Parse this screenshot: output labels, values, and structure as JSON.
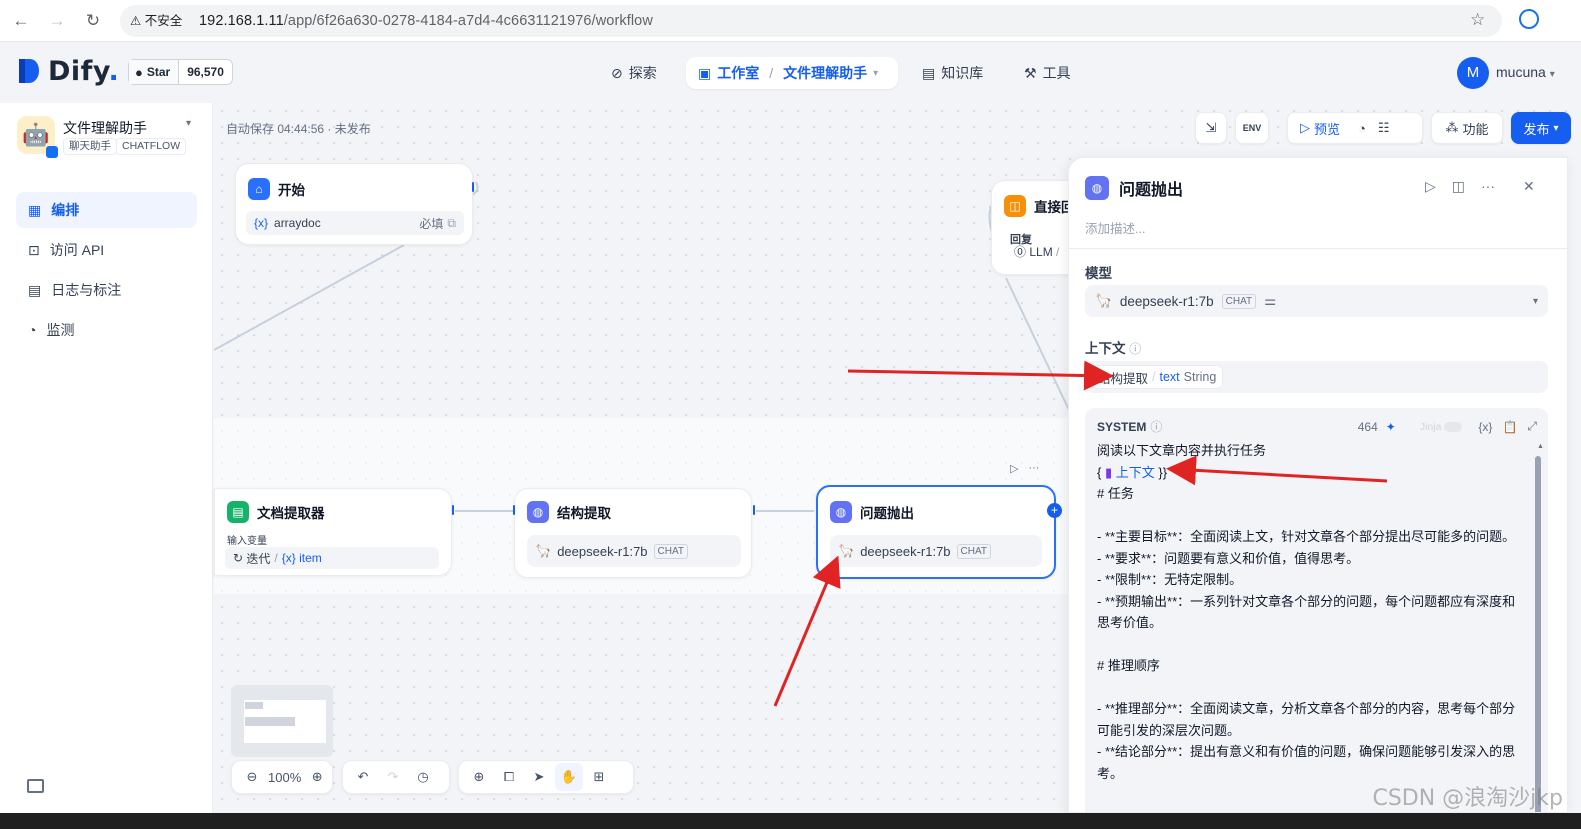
{
  "browser": {
    "insecure_label": "不安全",
    "url_host": "192.168.1.11",
    "url_path": "/app/6f26a630-0278-4184-a7d4-4c6631121976/workflow"
  },
  "header": {
    "logo": "Dify",
    "github_star_label": "Star",
    "github_star_count": "96,570",
    "nav_explore": "探索",
    "nav_studio": "工作室",
    "current_app": "文件理解助手",
    "nav_knowledge": "知识库",
    "nav_tools": "工具",
    "avatar_initial": "M",
    "username": "mucuna"
  },
  "sidebar": {
    "app_name": "文件理解助手",
    "tag_mode": "聊天助手",
    "tag_type": "CHATFLOW",
    "items": [
      {
        "label": "编排",
        "icon": "layout-icon"
      },
      {
        "label": "访问 API",
        "icon": "terminal-icon"
      },
      {
        "label": "日志与标注",
        "icon": "doc-icon"
      },
      {
        "label": "监测",
        "icon": "gauge-icon"
      }
    ]
  },
  "canvas": {
    "autosave": "自动保存 04:44:56 · 未发布",
    "zoom": "100%",
    "start_node": {
      "title": "开始",
      "var": "arraydoc",
      "required": "必填"
    },
    "reply_node": {
      "title": "直接回",
      "label": "回复",
      "llm": "LLM"
    },
    "extractor_node": {
      "title": "文档提取器",
      "input_label": "输入变量",
      "iter": "迭代",
      "item": "item"
    },
    "struct_node": {
      "title": "结构提取",
      "model": "deepseek-r1:7b",
      "badge": "CHAT"
    },
    "question_node": {
      "title": "问题抛出",
      "model": "deepseek-r1:7b",
      "badge": "CHAT"
    }
  },
  "toolbar": {
    "preview": "预览",
    "features": "功能",
    "publish": "发布",
    "env": "ENV"
  },
  "panel": {
    "title": "问题抛出",
    "description_placeholder": "添加描述...",
    "model_label": "模型",
    "model_name": "deepseek-r1:7b",
    "model_badge": "CHAT",
    "context_label": "上下文",
    "context_node": "结构提取",
    "context_var": "text",
    "context_type": "String",
    "system_label": "SYSTEM",
    "token_count": "464",
    "jinja_label": "Jinja",
    "prompt_line1": "阅读以下文章内容并执行任务",
    "prompt_ctx_open": "{",
    "prompt_ctx_var": "上下文",
    "prompt_ctx_close": "}}",
    "prompt_body": "# 任务\n\n- **主要目标**：全面阅读上文，针对文章各个部分提出尽可能多的问题。\n- **要求**：问题要有意义和价值，值得思考。\n- **限制**：无特定限制。\n- **预期输出**：一系列针对文章各个部分的问题，每个问题都应有深度和思考价值。\n\n# 推理顺序\n\n- **推理部分**：全面阅读文章，分析文章各个部分的内容，思考每个部分可能引发的深层次问题。\n- **结论部分**：提出有意义和有价值的问题，确保问题能够引发深入的思考。"
  },
  "watermark": "CSDN @浪淘沙jkp",
  "colors": {
    "accent": "#155eef",
    "arrow": "#e02424"
  }
}
